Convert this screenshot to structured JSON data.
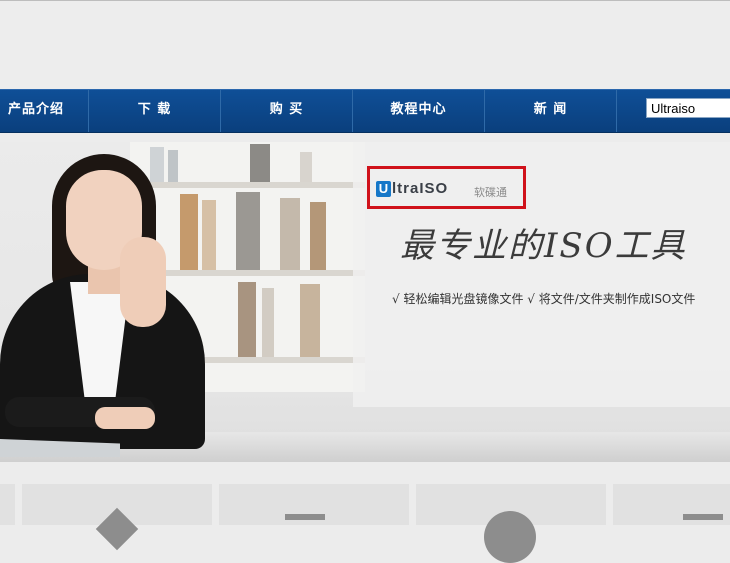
{
  "nav": {
    "items": [
      {
        "label": "产品介绍"
      },
      {
        "label": "下 载"
      },
      {
        "label": "购 买"
      },
      {
        "label": "教程中心"
      },
      {
        "label": "新 闻"
      }
    ],
    "search_value": "Ultraiso"
  },
  "banner": {
    "logo_badge": "U",
    "logo_text": "ltraISO",
    "logo_cn": "软碟通",
    "slogan": "最专业的ISO工具",
    "features": "√ 轻松编辑光盘镜像文件  √ 将文件/文件夹制作成ISO文件"
  },
  "colors": {
    "nav_bg": "#0a4789",
    "highlight_border": "#d0121b",
    "logo_blue": "#1677c8"
  }
}
